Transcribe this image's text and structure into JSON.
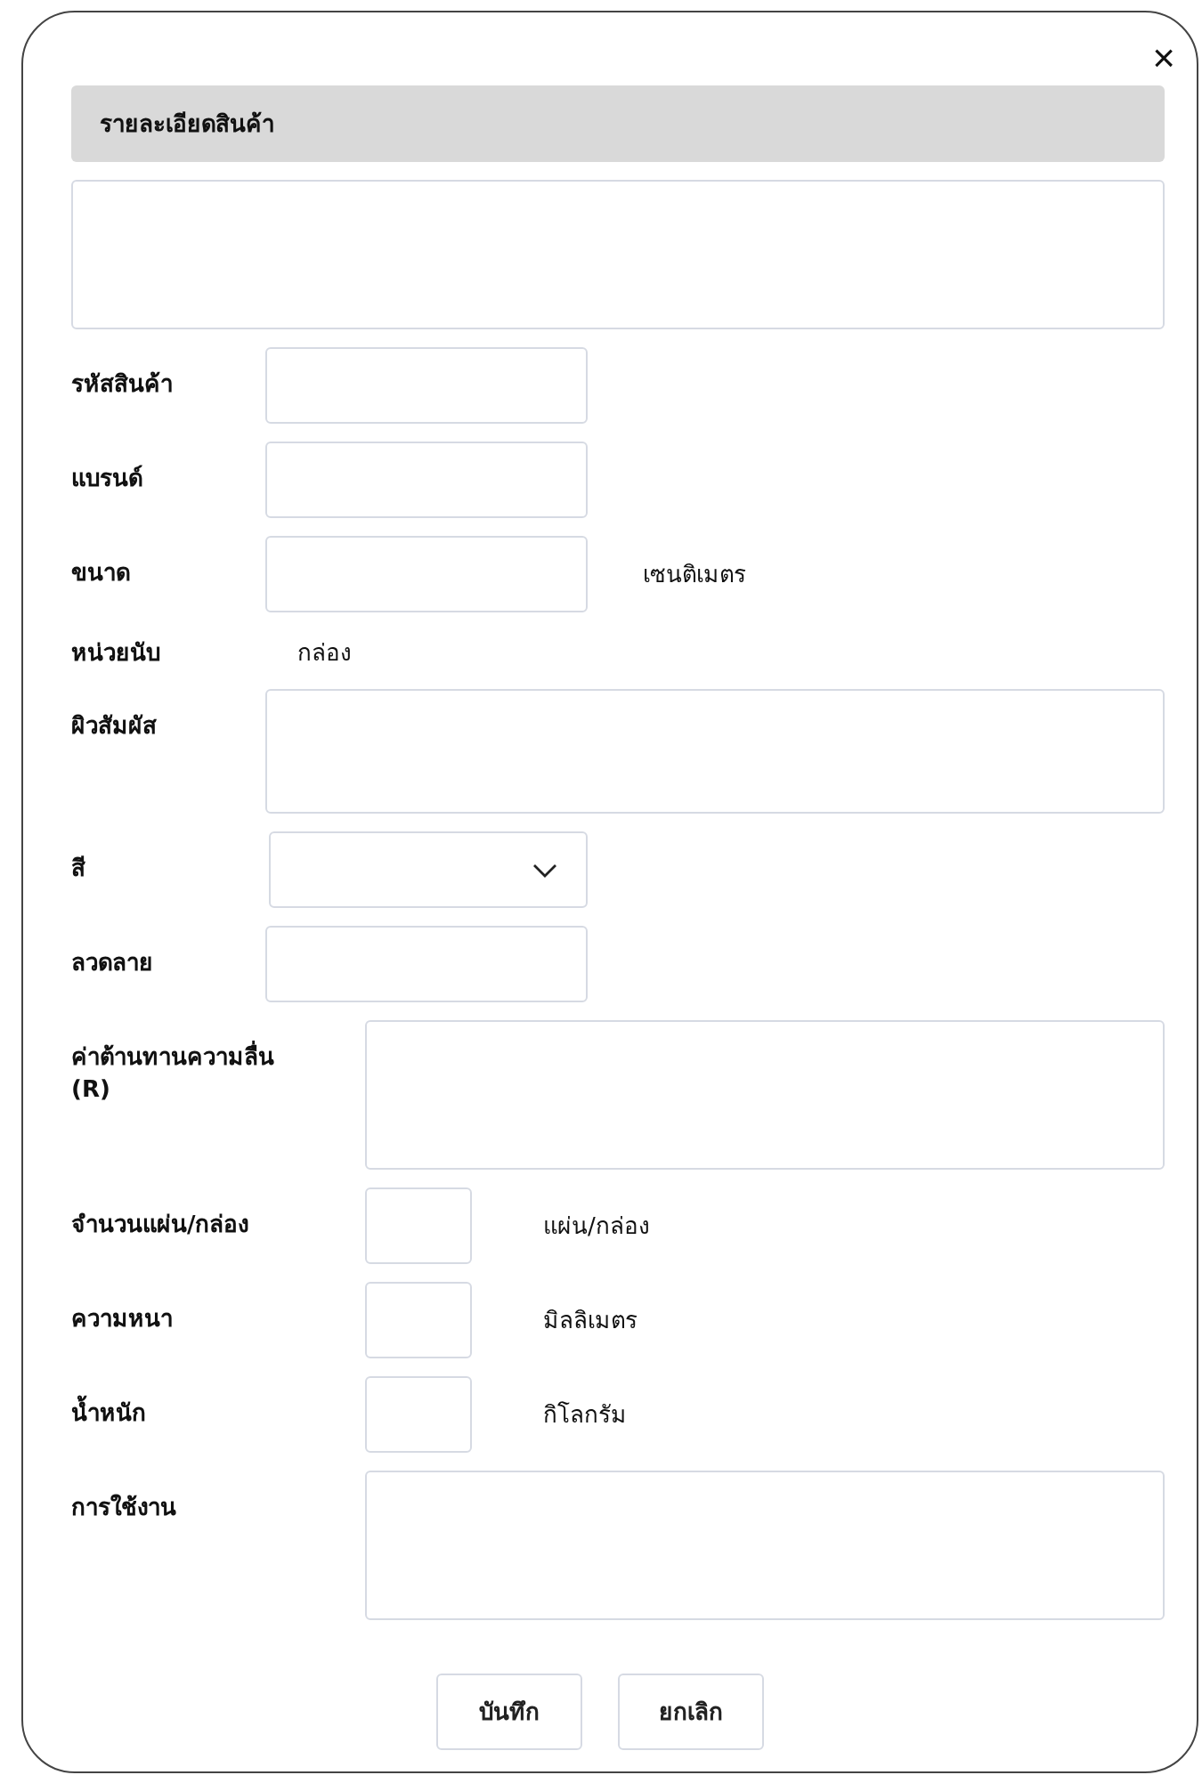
{
  "dialog": {
    "close_icon": "×",
    "title": "รายละเอียดสินค้า",
    "fields": [
      {
        "kind": "input",
        "label": "รหัสสินค้า"
      },
      {
        "kind": "input",
        "label": "แบรนด์"
      },
      {
        "kind": "input",
        "label": "ขนาด",
        "unit": "เซนติเมตร"
      },
      {
        "kind": "text",
        "label": "หน่วยนับ",
        "value": "กล่อง"
      },
      {
        "kind": "textarea",
        "label": "ผิวสัมผัส"
      },
      {
        "kind": "select",
        "label": "สี"
      },
      {
        "kind": "input",
        "label": "ลวดลาย"
      }
    ],
    "spec_fields": [
      {
        "kind": "textarea",
        "label": "ค่าต้านทานความลื่น (R)"
      },
      {
        "kind": "input",
        "label": "จำนวนแผ่น/กล่อง",
        "unit": "แผ่น/กล่อง"
      },
      {
        "kind": "input",
        "label": "ความหนา",
        "unit": "มิลลิเมตร"
      },
      {
        "kind": "input",
        "label": "น้ำหนัก",
        "unit": "กิโลกรัม"
      },
      {
        "kind": "textarea",
        "label": "การใช้งาน"
      }
    ],
    "buttons": [
      "บันทึก",
      "ยกเลิก"
    ]
  }
}
